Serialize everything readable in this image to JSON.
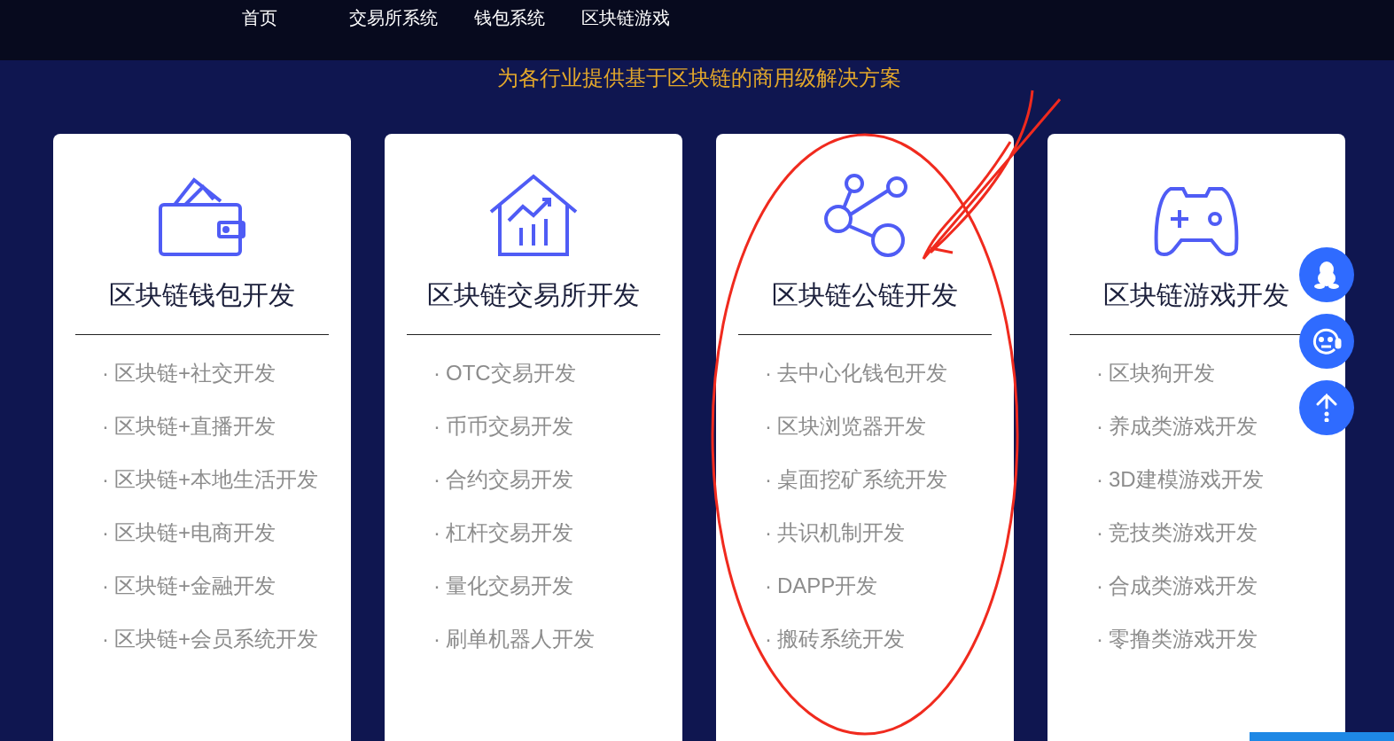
{
  "nav": {
    "items": [
      {
        "label": "首页"
      },
      {
        "label": "交易所系统"
      },
      {
        "label": "钱包系统"
      },
      {
        "label": "区块链游戏"
      }
    ]
  },
  "subtitle": "为各行业提供基于区块链的商用级解决方案",
  "cards": [
    {
      "kind": "wallet",
      "title": "区块链钱包开发",
      "items": [
        "区块链+社交开发",
        "区块链+直播开发",
        "区块链+本地生活开发",
        "区块链+电商开发",
        "区块链+金融开发",
        "区块链+会员系统开发"
      ]
    },
    {
      "kind": "exchange",
      "title": "区块链交易所开发",
      "items": [
        "OTC交易开发",
        "币币交易开发",
        "合约交易开发",
        "杠杆交易开发",
        "量化交易开发",
        "刷单机器人开发"
      ]
    },
    {
      "kind": "share",
      "title": "区块链公链开发",
      "items": [
        "去中心化钱包开发",
        "区块浏览器开发",
        "桌面挖矿系统开发",
        "共识机制开发",
        "DAPP开发",
        "搬砖系统开发"
      ]
    },
    {
      "kind": "game",
      "title": "区块链游戏开发",
      "items": [
        "区块狗开发",
        "养成类游戏开发",
        "3D建模游戏开发",
        "竞技类游戏开发",
        "合成类游戏开发",
        "零撸类游戏开发"
      ]
    }
  ],
  "bullet": "·",
  "float_buttons": [
    {
      "kind": "penguin"
    },
    {
      "kind": "headset"
    },
    {
      "kind": "up"
    }
  ]
}
